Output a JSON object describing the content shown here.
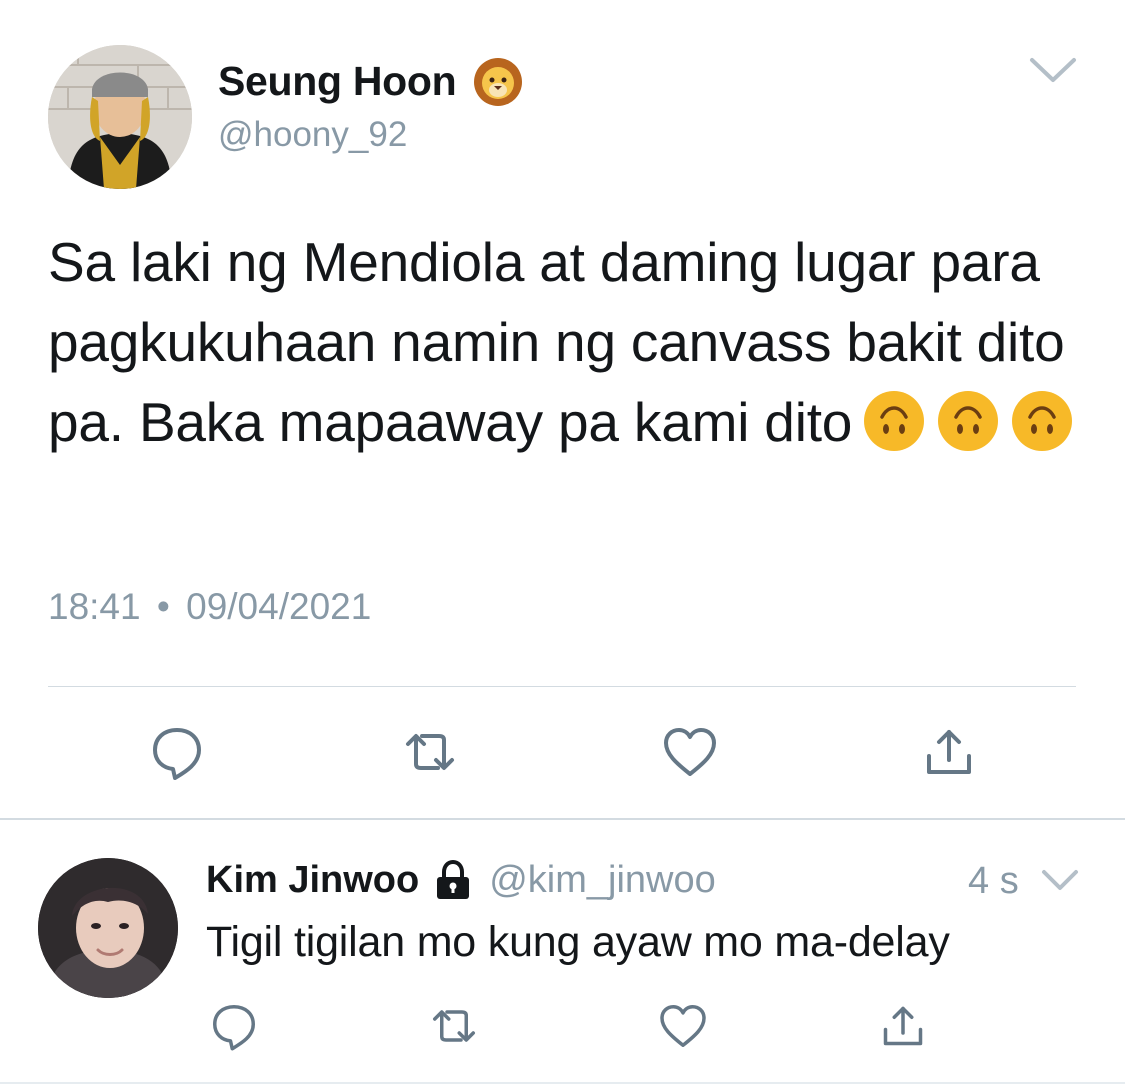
{
  "main_tweet": {
    "display_name": "Seung Hoon",
    "name_emoji": "lion-face-emoji",
    "handle": "@hoony_92",
    "text": "Sa laki ng Mendiola at daming lugar para pagkukuhaan namin ng canvass bakit dito pa. Baka mapaaway pa kami dito",
    "text_emoji": [
      "upside-down-face-emoji",
      "upside-down-face-emoji",
      "upside-down-face-emoji"
    ],
    "time": "18:41",
    "separator": "•",
    "date": "09/04/2021",
    "actions": [
      "reply-icon",
      "retweet-icon",
      "like-icon",
      "share-icon"
    ]
  },
  "reply_tweet": {
    "display_name": "Kim Jinwoo",
    "lock_icon": "lock-icon",
    "handle": "@kim_jinwoo",
    "age": "4 s",
    "text": "Tigil tigilan mo kung ayaw mo ma-delay",
    "actions": [
      "reply-icon",
      "retweet-icon",
      "like-icon",
      "share-icon"
    ]
  },
  "colors": {
    "text": "#14171a",
    "secondary": "#8899a6",
    "divider": "#d3dbe1",
    "icon": "#657786"
  }
}
